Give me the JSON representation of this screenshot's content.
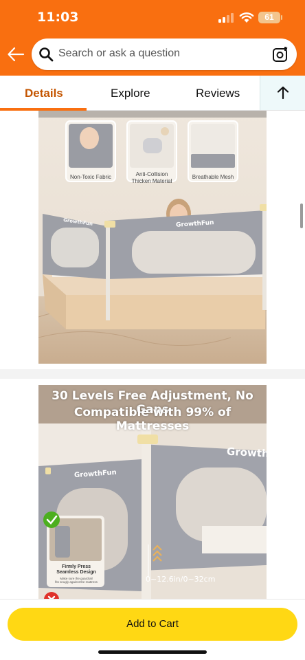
{
  "status_bar": {
    "time": "11:03",
    "battery": "61"
  },
  "search": {
    "placeholder": "Search or ask a question"
  },
  "tabs": [
    {
      "label": "Details",
      "active": true
    },
    {
      "label": "Explore"
    },
    {
      "label": "Reviews"
    }
  ],
  "image1": {
    "feature_labels": [
      "Non-Toxic Fabric",
      "Anti-Collision\nThicken Material",
      "Breathable Mesh"
    ],
    "brand": "GrowthFun"
  },
  "image2": {
    "headline_line1": "30 Levels Free Adjustment, No Gaps",
    "headline_line2": "Compatible with 99% of Mattresses",
    "brand": "GrowthFun",
    "measure": "0~12.6in/0~32cm",
    "inset_title": "Firmly Press\nSeamless Design",
    "inset_sub": "Make sure the guardrail\nfits snugly against the mattress"
  },
  "actions": {
    "add_to_cart": "Add to Cart"
  },
  "colors": {
    "brand_orange": "#f96f10",
    "cart_yellow": "#ffd814",
    "active_tab": "#c45500"
  }
}
